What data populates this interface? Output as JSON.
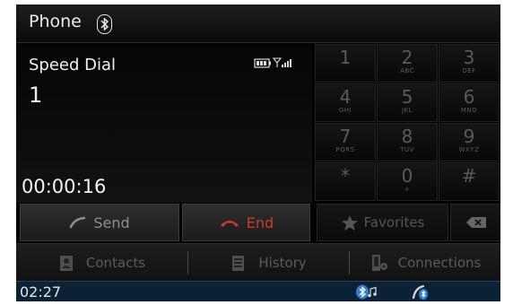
{
  "header": {
    "title": "Phone"
  },
  "call": {
    "label": "Speed Dial",
    "number": "1",
    "duration": "00:00:16",
    "send_label": "Send",
    "end_label": "End"
  },
  "keypad": [
    {
      "digit": "1",
      "letters": ""
    },
    {
      "digit": "2",
      "letters": "ABC"
    },
    {
      "digit": "3",
      "letters": "DEF"
    },
    {
      "digit": "4",
      "letters": "GHI"
    },
    {
      "digit": "5",
      "letters": "JKL"
    },
    {
      "digit": "6",
      "letters": "MNO"
    },
    {
      "digit": "7",
      "letters": "PQRS"
    },
    {
      "digit": "8",
      "letters": "TUV"
    },
    {
      "digit": "9",
      "letters": "WXYZ"
    },
    {
      "digit": "*",
      "letters": ""
    },
    {
      "digit": "0",
      "letters": "+"
    },
    {
      "digit": "#",
      "letters": ""
    }
  ],
  "favorites_label": "Favorites",
  "menu": {
    "contacts": "Contacts",
    "history": "History",
    "connections": "Connections"
  },
  "status": {
    "clock": "02:27"
  },
  "colors": {
    "end_red": "#cd3a2b",
    "status_blue": "#0a2236",
    "bt_blue": "#2d7fd0"
  }
}
